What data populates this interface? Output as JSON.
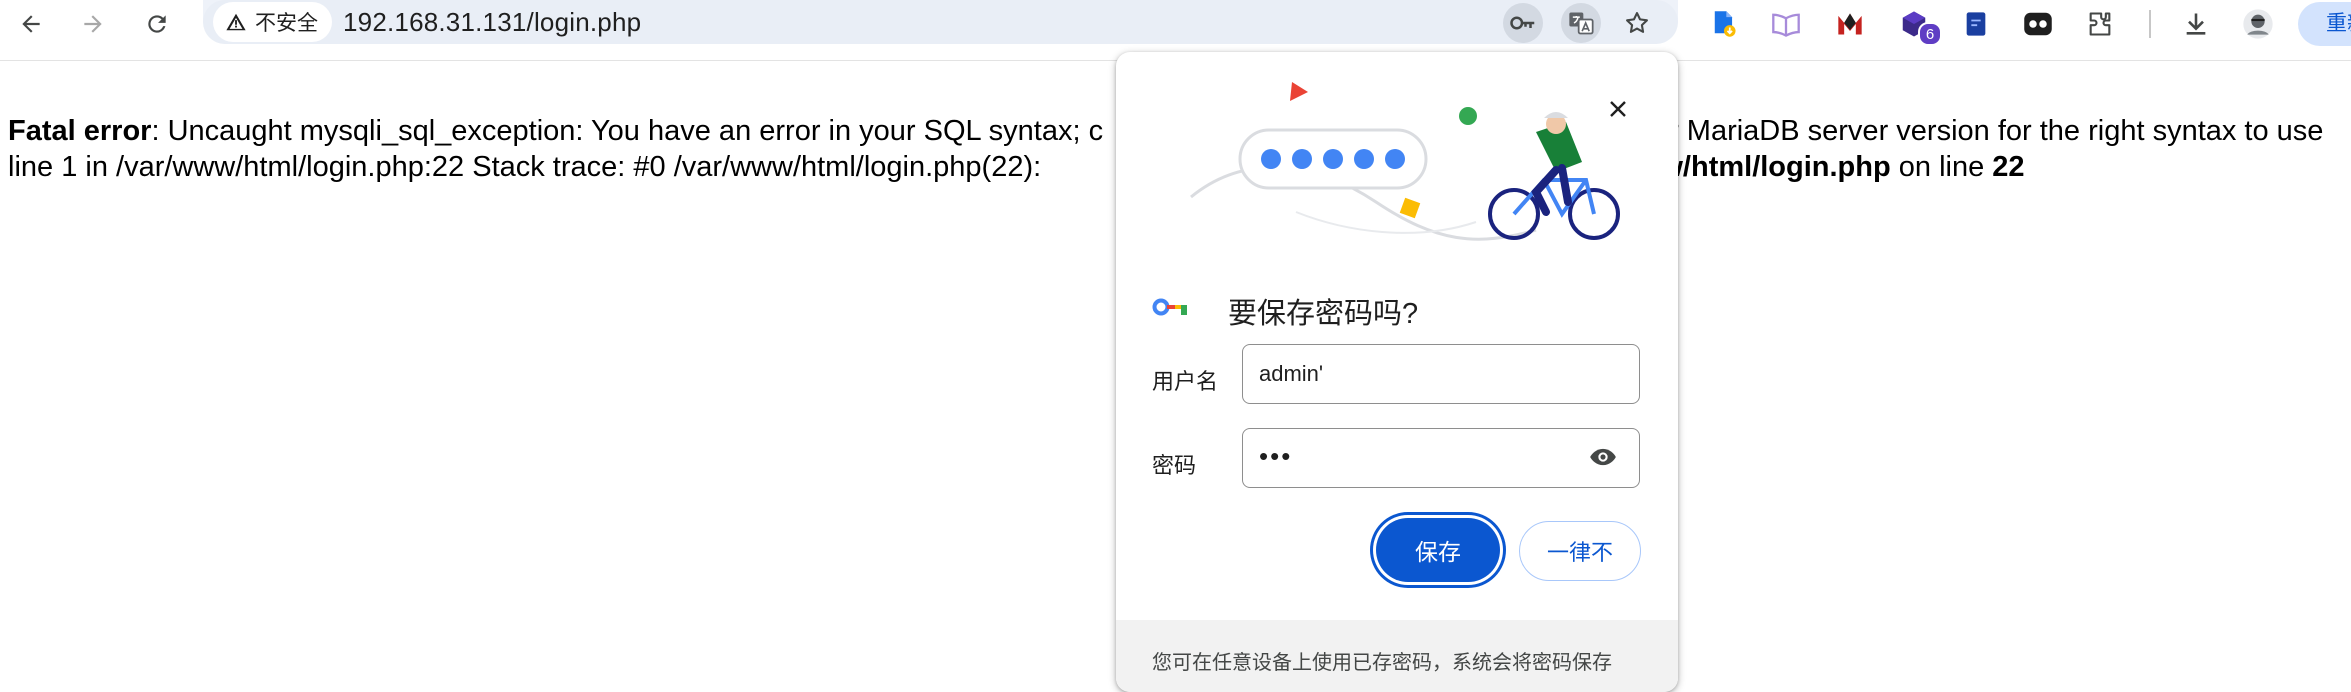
{
  "toolbar": {
    "security_label": "不安全",
    "url": "192.168.31.131/login.php",
    "extension_badge": "6",
    "restart_label": "重新"
  },
  "error": {
    "line1_bold": "Fatal error",
    "line1_left": ": Uncaught mysqli_sql_exception: You have an error in your SQL syntax; c",
    "line1_right": "r MariaDB server version for the right syntax to use",
    "line2_left": "line 1 in /var/www/html/login.php:22 Stack trace: #0 /var/www/html/login.php(22):",
    "line2_right_bold": "/www/html/login.php",
    "line2_right_mid": " on line ",
    "line2_right_num": "22"
  },
  "popup": {
    "title": "要保存密码吗?",
    "username_label": "用户名",
    "username_value": "admin'",
    "password_label": "密码",
    "password_dots": "•••",
    "save_label": "保存",
    "never_label": "一律不",
    "footer_text": "您可在任意设备上使用已存密码，系统会将密码保存"
  },
  "colors": {
    "accent": "#0b57d0",
    "illus_blue": "#4285f4",
    "illus_green": "#34a853",
    "illus_red": "#ea4335",
    "illus_yellow": "#fbbc04"
  }
}
